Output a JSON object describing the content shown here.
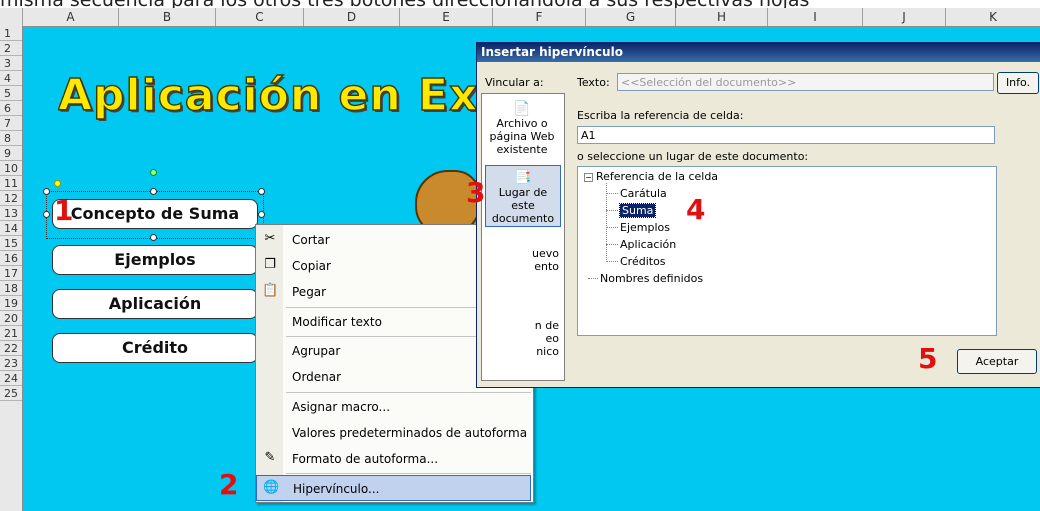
{
  "caption": "misma secuencia para los otros tres botones direccionandola a sus respectivas hojas",
  "sheet": {
    "columns": [
      "A",
      "B",
      "C",
      "D",
      "E",
      "F",
      "G",
      "H",
      "I",
      "J",
      "K"
    ],
    "rows": [
      "1",
      "2",
      "3",
      "4",
      "5",
      "6",
      "7",
      "8",
      "9",
      "10",
      "11",
      "12",
      "13",
      "14",
      "15",
      "16",
      "17",
      "18",
      "19",
      "20",
      "21",
      "22",
      "23",
      "24",
      "25"
    ],
    "title": "Aplicación en Excel",
    "buttons": [
      "Concepto de Suma",
      "Ejemplos",
      "Aplicación",
      "Crédito"
    ]
  },
  "step_numbers": [
    "1",
    "2",
    "3",
    "4",
    "5"
  ],
  "context_menu": {
    "items": [
      {
        "icon": "scissors-icon",
        "glyph": "✂",
        "label": "Cortar"
      },
      {
        "icon": "copy-icon",
        "glyph": "❐",
        "label": "Copiar"
      },
      {
        "icon": "paste-icon",
        "glyph": "📋",
        "label": "Pegar"
      },
      {
        "icon": "",
        "glyph": "",
        "label": "Modificar texto"
      },
      {
        "icon": "",
        "glyph": "",
        "label": "Agrupar"
      },
      {
        "icon": "",
        "glyph": "",
        "label": "Ordenar"
      },
      {
        "icon": "",
        "glyph": "",
        "label": "Asignar macro..."
      },
      {
        "icon": "",
        "glyph": "",
        "label": "Valores predeterminados de autoforma"
      },
      {
        "icon": "format-autoshape-icon",
        "glyph": "✎",
        "label": "Formato de autoforma..."
      },
      {
        "icon": "hyperlink-icon",
        "glyph": "🌐",
        "label": "Hipervínculo..."
      }
    ]
  },
  "dialog": {
    "title": "Insertar hipervínculo",
    "link_to_label": "Vincular a:",
    "text_label": "Texto:",
    "text_value": "<<Selección del documento>>",
    "info_button": "Info.",
    "nav": [
      {
        "label": "Archivo o página Web existente"
      },
      {
        "label": "Lugar de este documento"
      },
      {
        "label": "Crear nuevo documento"
      },
      {
        "label": "Dirección de correo electrónico"
      }
    ],
    "nav_visible": [
      "uevo",
      "ento",
      "n de",
      "eo",
      "nico"
    ],
    "cell_ref_label": "Escriba la referencia de celda:",
    "cell_ref_value": "A1",
    "place_label": "o seleccione un lugar de este documento:",
    "tree": {
      "root": "Referencia de la celda",
      "children": [
        "Carátula",
        "Suma",
        "Ejemplos",
        "Aplicación",
        "Créditos"
      ],
      "selected": "Suma",
      "other": "Nombres definidos"
    },
    "ok_button": "Aceptar"
  }
}
